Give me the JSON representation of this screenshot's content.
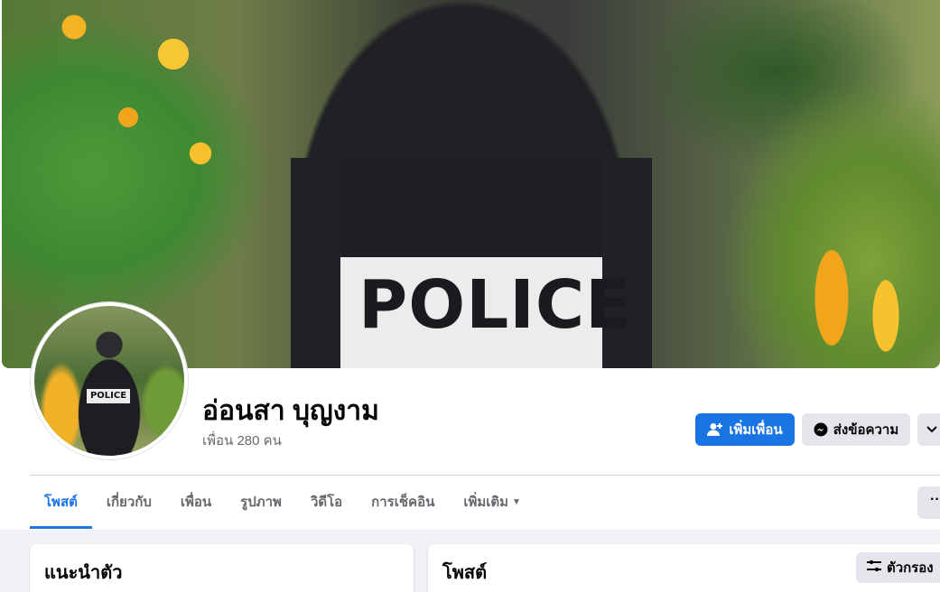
{
  "profile": {
    "name": "อ่อนสา บุญงาม",
    "friends_count": "เพื่อน 280 คน",
    "cover_text": "POLICE",
    "avatar_badge": "POLICE"
  },
  "actions": {
    "add_friend": "เพิ่มเพื่อน",
    "message": "ส่งข้อความ",
    "more_icon": "chevron-down-icon"
  },
  "tabs": [
    {
      "label": "โพสต์",
      "active": true
    },
    {
      "label": "เกี่ยวกับ",
      "active": false
    },
    {
      "label": "เพื่อน",
      "active": false
    },
    {
      "label": "รูปภาพ",
      "active": false
    },
    {
      "label": "วิดีโอ",
      "active": false
    },
    {
      "label": "การเช็คอิน",
      "active": false
    },
    {
      "label": "เพิ่มเติม",
      "active": false
    }
  ],
  "tab_more_icon": "ellipsis-icon",
  "intro": {
    "title": "แนะนำตัว"
  },
  "posts": {
    "title": "โพสต์",
    "filter_label": "ตัวกรอง"
  },
  "colors": {
    "accent": "#1b74e4",
    "secondary_button": "#e4e6eb",
    "page_background": "#f0f2f5"
  }
}
